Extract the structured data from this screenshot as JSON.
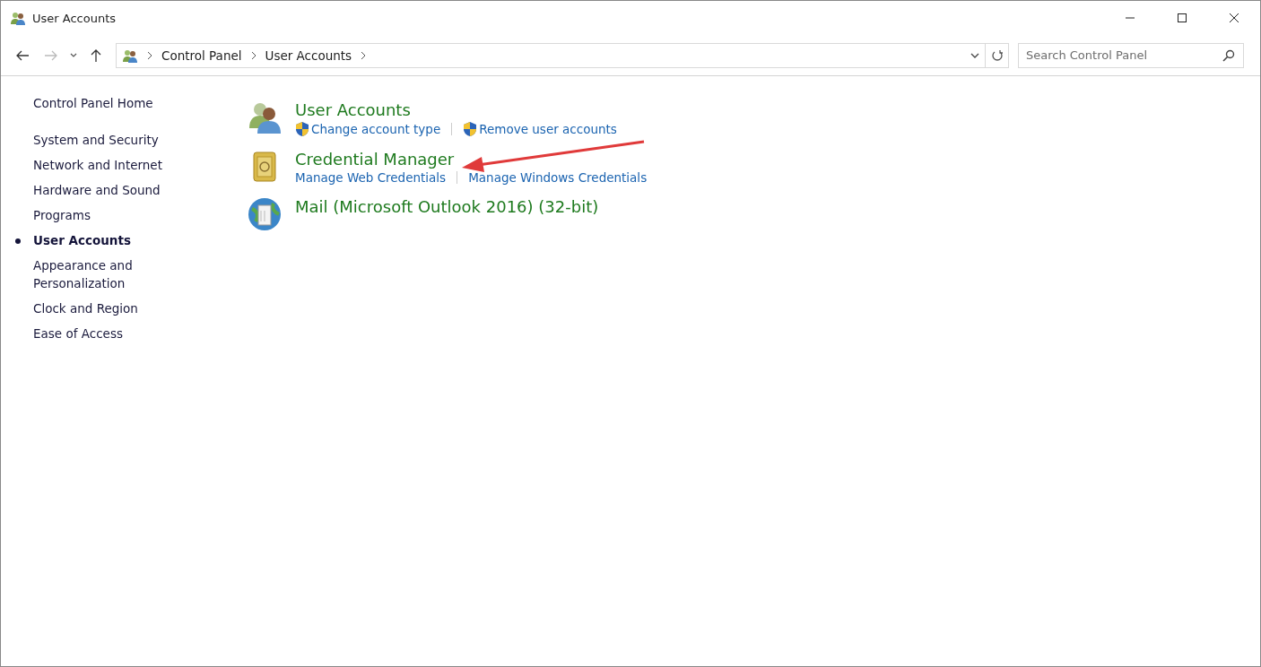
{
  "window": {
    "title": "User Accounts"
  },
  "address_bar": {
    "breadcrumbs": [
      "Control Panel",
      "User Accounts"
    ]
  },
  "search": {
    "placeholder": "Search Control Panel"
  },
  "sidebar": {
    "items": [
      {
        "label": "Control Panel Home",
        "kind": "home",
        "selected": false
      },
      {
        "label": "System and Security",
        "kind": "category",
        "selected": false
      },
      {
        "label": "Network and Internet",
        "kind": "category",
        "selected": false
      },
      {
        "label": "Hardware and Sound",
        "kind": "category",
        "selected": false
      },
      {
        "label": "Programs",
        "kind": "category",
        "selected": false
      },
      {
        "label": "User Accounts",
        "kind": "category",
        "selected": true
      },
      {
        "label": "Appearance and Personalization",
        "kind": "category",
        "selected": false
      },
      {
        "label": "Clock and Region",
        "kind": "category",
        "selected": false
      },
      {
        "label": "Ease of Access",
        "kind": "category",
        "selected": false
      }
    ]
  },
  "sections": [
    {
      "title": "User Accounts",
      "kind": "users",
      "links": [
        {
          "label": "Change account type",
          "shield": true
        },
        {
          "label": "Remove user accounts",
          "shield": true
        }
      ]
    },
    {
      "title": "Credential Manager",
      "kind": "vault",
      "links": [
        {
          "label": "Manage Web Credentials",
          "shield": false
        },
        {
          "label": "Manage Windows Credentials",
          "shield": false
        }
      ]
    },
    {
      "title": "Mail (Microsoft Outlook 2016) (32-bit)",
      "kind": "mail"
    }
  ]
}
